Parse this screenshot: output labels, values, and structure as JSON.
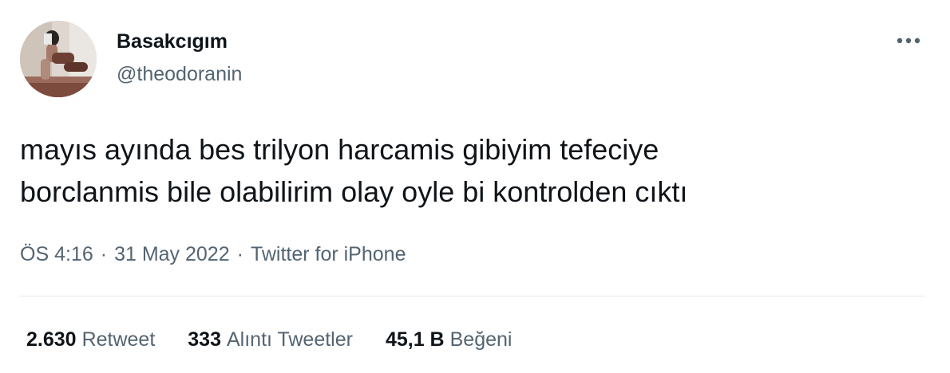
{
  "author": {
    "display_name": "Basakcıgım",
    "handle": "@theodoranin",
    "avatar_icon": "profile-photo"
  },
  "more_icon": "more-horizontal-icon",
  "tweet": {
    "text_line_1": "mayıs ayında bes trilyon harcamis gibiyim tefeciye",
    "text_line_2": "borclanmis bile olabilirim olay oyle bi kontrolden cıktı"
  },
  "meta": {
    "time": "ÖS 4:16",
    "separator": "·",
    "date": "31 May 2022",
    "source": "Twitter for iPhone"
  },
  "stats": {
    "retweets": {
      "count": "2.630",
      "label": "Retweet"
    },
    "quotes": {
      "count": "333",
      "label": "Alıntı Tweetler"
    },
    "likes": {
      "count": "45,1 B",
      "label": "Beğeni"
    }
  },
  "colors": {
    "primary_text": "#0f1419",
    "secondary_text": "#536471",
    "divider": "#e4e8ec"
  }
}
